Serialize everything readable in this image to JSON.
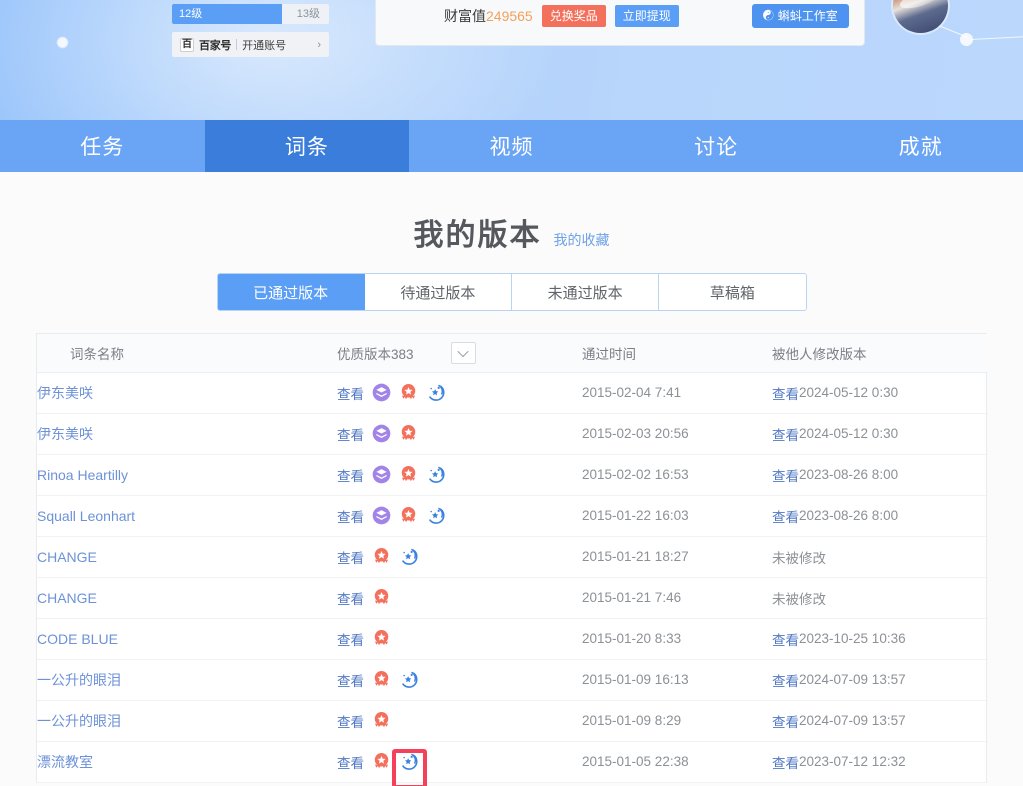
{
  "header": {
    "level": {
      "current_label": "12级",
      "next_label": "13级",
      "progress_percent": 70
    },
    "baijiahao": {
      "logo_text": "百",
      "brand": "百家号",
      "action": "开通账号",
      "arrow": "›"
    },
    "wealth": {
      "label": "财富值",
      "value": "249565",
      "exchange_button": "兑换奖品",
      "withdraw_button": "立即提现",
      "studio_button": "蝌蚪工作室",
      "studio_icon_glyph": "☯"
    }
  },
  "main_nav": {
    "items": [
      {
        "label": "任务",
        "active": false
      },
      {
        "label": "词条",
        "active": true
      },
      {
        "label": "视频",
        "active": false
      },
      {
        "label": "讨论",
        "active": false
      },
      {
        "label": "成就",
        "active": false
      }
    ]
  },
  "page": {
    "title": "我的版本",
    "favorites_link": "我的收藏"
  },
  "subtabs": [
    {
      "label": "已通过版本",
      "active": true
    },
    {
      "label": "待通过版本",
      "active": false
    },
    {
      "label": "未通过版本",
      "active": false
    },
    {
      "label": "草稿箱",
      "active": false
    }
  ],
  "table": {
    "headers": {
      "name": "词条名称",
      "version": "优质版本383",
      "pass_time": "通过时间",
      "modified": "被他人修改版本"
    },
    "view_label": "查看",
    "not_modified_label": "未被修改",
    "rows": [
      {
        "name": "伊东美咲",
        "view": "查看",
        "badges": [
          "layers",
          "medal",
          "swirl"
        ],
        "pass_time": "2015-02-04 7:41",
        "modified_link": "查看",
        "modified_time": "2024-05-12 0:30"
      },
      {
        "name": "伊东美咲",
        "view": "查看",
        "badges": [
          "layers",
          "medal"
        ],
        "pass_time": "2015-02-03 20:56",
        "modified_link": "查看",
        "modified_time": "2024-05-12 0:30"
      },
      {
        "name": "Rinoa Heartilly",
        "view": "查看",
        "badges": [
          "layers",
          "medal",
          "swirl"
        ],
        "pass_time": "2015-02-02 16:53",
        "modified_link": "查看",
        "modified_time": "2023-08-26 8:00"
      },
      {
        "name": "Squall Leonhart",
        "view": "查看",
        "badges": [
          "layers",
          "medal",
          "swirl"
        ],
        "pass_time": "2015-01-22 16:03",
        "modified_link": "查看",
        "modified_time": "2023-08-26 8:00"
      },
      {
        "name": "CHANGE",
        "view": "查看",
        "badges": [
          "medal",
          "swirl"
        ],
        "pass_time": "2015-01-21 18:27",
        "modified_link": "",
        "modified_time": "未被修改"
      },
      {
        "name": "CHANGE",
        "view": "查看",
        "badges": [
          "medal"
        ],
        "pass_time": "2015-01-21 7:46",
        "modified_link": "",
        "modified_time": "未被修改"
      },
      {
        "name": "CODE BLUE",
        "view": "查看",
        "badges": [
          "medal"
        ],
        "pass_time": "2015-01-20 8:33",
        "modified_link": "查看",
        "modified_time": "2023-10-25 10:36"
      },
      {
        "name": "一公升的眼泪",
        "view": "查看",
        "badges": [
          "medal",
          "swirl"
        ],
        "pass_time": "2015-01-09 16:13",
        "modified_link": "查看",
        "modified_time": "2024-07-09 13:57"
      },
      {
        "name": "一公升的眼泪",
        "view": "查看",
        "badges": [
          "medal"
        ],
        "pass_time": "2015-01-09 8:29",
        "modified_link": "查看",
        "modified_time": "2024-07-09 13:57"
      },
      {
        "name": "漂流教室",
        "view": "查看",
        "badges": [
          "medal",
          "swirl"
        ],
        "pass_time": "2015-01-05 22:38",
        "modified_link": "查看",
        "modified_time": "2023-07-12 12:32"
      }
    ]
  },
  "annotation": {
    "highlight_color": "#f4405a",
    "box_target": "medal-badge-icon-row-6",
    "underline_target": "table-row-6"
  },
  "colors": {
    "nav_blue": "#6aa4f5",
    "nav_active_blue": "#3a7ddb",
    "accent_blue": "#5a9ef5",
    "wealth_orange": "#f2a25c",
    "exchange_red": "#f3715c",
    "link_blue": "#6d92d8",
    "medal_red": "#f3715c",
    "layers_purple": "#a284e8",
    "swirl_blue": "#3a82e0"
  }
}
